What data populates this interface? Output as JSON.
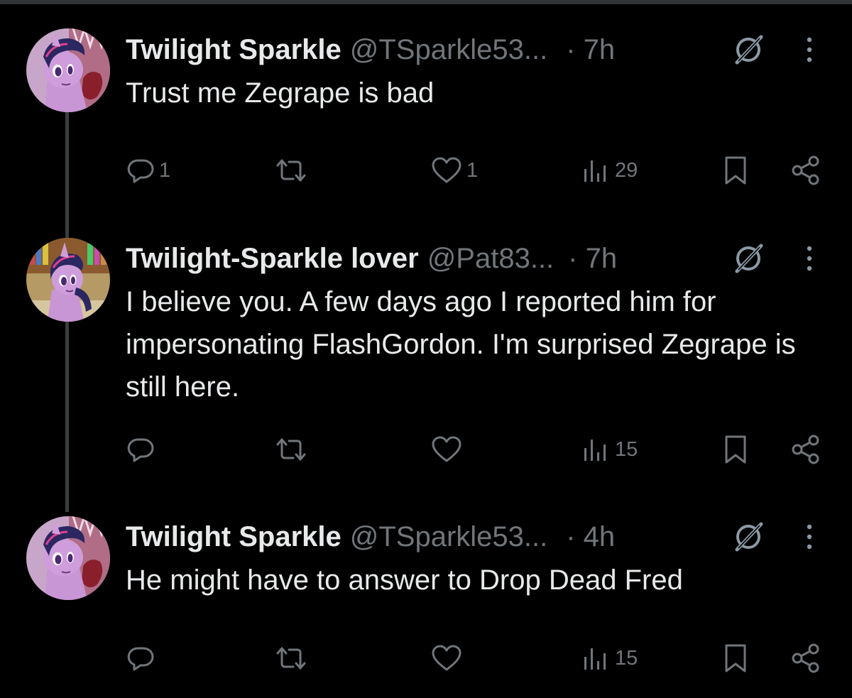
{
  "colors": {
    "background": "#000000",
    "text": "#e7e9ea",
    "secondary": "#71767b",
    "thread_line": "#3a3d40"
  },
  "posts": [
    {
      "display_name": "Twilight Sparkle",
      "handle": "@TSparkle53...",
      "time": "· 7h",
      "text": "Trust me Zegrape is bad",
      "replies": "1",
      "reposts": "",
      "likes": "1",
      "views": "29",
      "icons": [
        "reply-icon",
        "repost-icon",
        "like-icon",
        "views-icon",
        "bookmark-icon",
        "share-icon",
        "grok-icon",
        "more-icon"
      ]
    },
    {
      "display_name": "Twilight-Sparkle lover",
      "handle": "@Pat83...",
      "time": "· 7h",
      "text": "I believe you. A few days ago I reported him for impersonating FlashGordon. I'm surprised Zegrape is still here.",
      "replies": "",
      "reposts": "",
      "likes": "",
      "views": "15",
      "icons": [
        "reply-icon",
        "repost-icon",
        "like-icon",
        "views-icon",
        "bookmark-icon",
        "share-icon",
        "grok-icon",
        "more-icon"
      ]
    },
    {
      "display_name": "Twilight Sparkle",
      "handle": "@TSparkle53...",
      "time": "· 4h",
      "text": "He might have to answer to Drop Dead Fred",
      "replies": "",
      "reposts": "",
      "likes": "",
      "views": "15",
      "icons": [
        "reply-icon",
        "repost-icon",
        "like-icon",
        "views-icon",
        "bookmark-icon",
        "share-icon",
        "grok-icon",
        "more-icon"
      ]
    }
  ]
}
